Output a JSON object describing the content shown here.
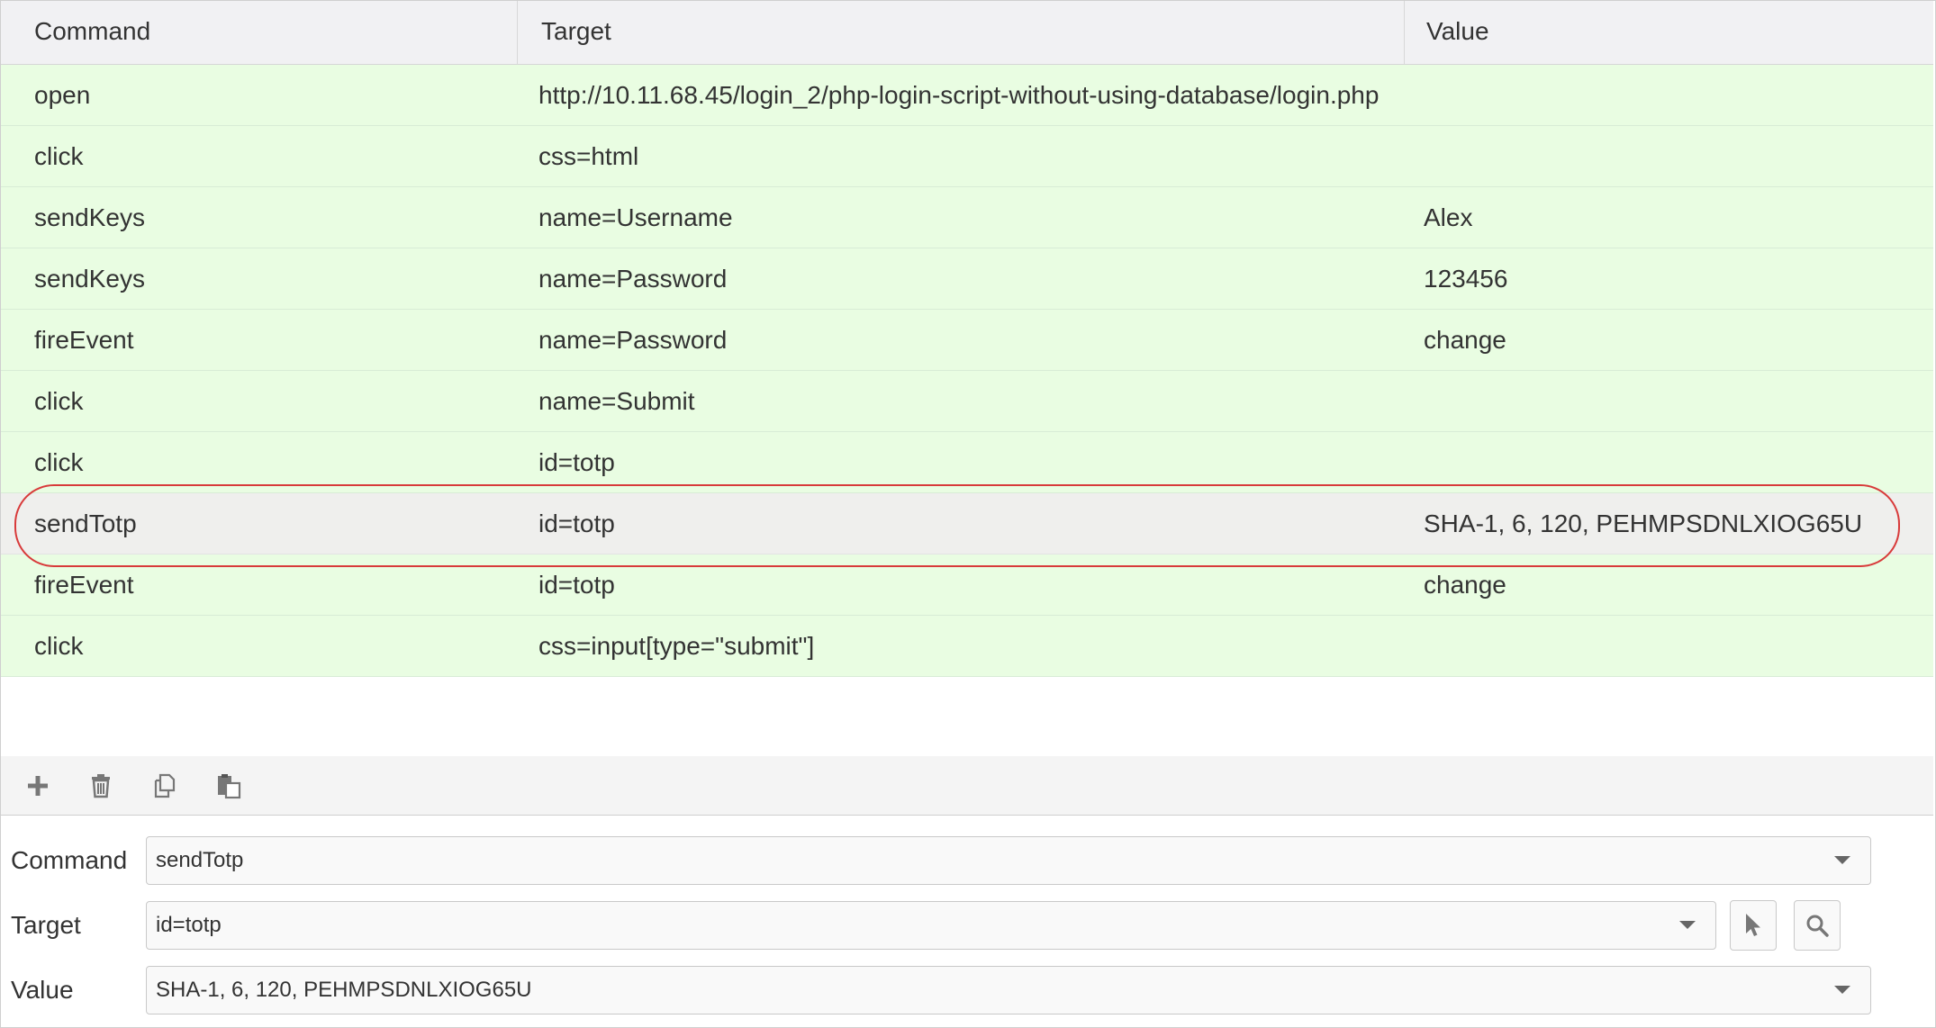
{
  "table": {
    "headers": {
      "command": "Command",
      "target": "Target",
      "value": "Value"
    },
    "rows": [
      {
        "command": "open",
        "target": "http://10.11.68.45/login_2/php-login-script-without-using-database/login.php",
        "value": ""
      },
      {
        "command": "click",
        "target": "css=html",
        "value": ""
      },
      {
        "command": "sendKeys",
        "target": "name=Username",
        "value": "Alex"
      },
      {
        "command": "sendKeys",
        "target": "name=Password",
        "value": "123456"
      },
      {
        "command": "fireEvent",
        "target": "name=Password",
        "value": "change"
      },
      {
        "command": "click",
        "target": "name=Submit",
        "value": ""
      },
      {
        "command": "click",
        "target": "id=totp",
        "value": ""
      },
      {
        "command": "sendTotp",
        "target": "id=totp",
        "value": "SHA-1, 6, 120, PEHMPSDNLXIOG65U"
      },
      {
        "command": "fireEvent",
        "target": "id=totp",
        "value": "change"
      },
      {
        "command": "click",
        "target": "css=input[type=\"submit\"]",
        "value": ""
      }
    ],
    "selected_row": 7
  },
  "toolbar": {
    "icons": [
      "plus-icon",
      "trash-icon",
      "copy-icon",
      "paste-icon"
    ]
  },
  "editor": {
    "command": {
      "label": "Command",
      "value": "sendTotp"
    },
    "target": {
      "label": "Target",
      "value": "id=totp"
    },
    "value": {
      "label": "Value",
      "value": "SHA-1, 6, 120, PEHMPSDNLXIOG65U"
    },
    "buttons": [
      "select-target-icon",
      "find-target-icon"
    ]
  },
  "colors": {
    "row_executed": "#e9fde2",
    "row_selected": "#efefed",
    "highlight_outline": "#d83a3a",
    "header_bg": "#f1f1f3"
  }
}
